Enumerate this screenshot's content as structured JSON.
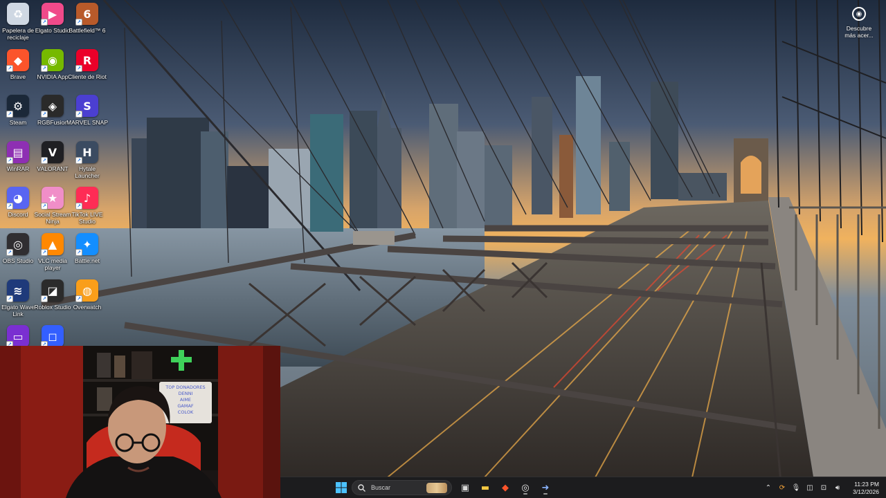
{
  "desktop": {
    "icons": [
      {
        "label": "Papelera de reciclaje",
        "icon": "recycle-bin-icon",
        "color": "#cfd8e3"
      },
      {
        "label": "Elgato Studio",
        "icon": "elgato-studio-icon",
        "color": "#f04a8a"
      },
      {
        "label": "Battlefield™ 6",
        "icon": "battlefield-icon",
        "color": "#b85a2a"
      },
      {
        "label": "Brave",
        "icon": "brave-icon",
        "color": "#fb542b"
      },
      {
        "label": "NVIDIA App",
        "icon": "nvidia-icon",
        "color": "#76b900"
      },
      {
        "label": "Cliente de Riot",
        "icon": "riot-client-icon",
        "color": "#eb0029"
      },
      {
        "label": "Steam",
        "icon": "steam-icon",
        "color": "#1b2838"
      },
      {
        "label": "RGBFusion",
        "icon": "rgbfusion-icon",
        "color": "#2a2a2a"
      },
      {
        "label": "MARVEL SNAP",
        "icon": "marvel-snap-icon",
        "color": "#4b3fd1"
      },
      {
        "label": "WinRAR",
        "icon": "winrar-icon",
        "color": "#8e2fb3"
      },
      {
        "label": "VALORANT",
        "icon": "valorant-icon",
        "color": "#1f1f23"
      },
      {
        "label": "Hytale Launcher",
        "icon": "hytale-icon",
        "color": "#3b4b61"
      },
      {
        "label": "Discord",
        "icon": "discord-icon",
        "color": "#5865f2"
      },
      {
        "label": "Social Stream Ninja",
        "icon": "social-stream-ninja-icon",
        "color": "#f08ec8"
      },
      {
        "label": "TikTok LIVE Studio",
        "icon": "tiktok-live-icon",
        "color": "#fe2c55"
      },
      {
        "label": "OBS Studio",
        "icon": "obs-icon",
        "color": "#302e31"
      },
      {
        "label": "VLC media player",
        "icon": "vlc-icon",
        "color": "#ff8800"
      },
      {
        "label": "Battle.net",
        "icon": "battlenet-icon",
        "color": "#148eff"
      },
      {
        "label": "Elgato Wave Link",
        "icon": "wave-link-icon",
        "color": "#1f3a7a"
      },
      {
        "label": "Roblox Studio",
        "icon": "roblox-studio-icon",
        "color": "#2b2b2b"
      },
      {
        "label": "Overwatch",
        "icon": "overwatch-icon",
        "color": "#f99e1a"
      },
      {
        "label": "",
        "icon": "cast-app-icon",
        "color": "#7a2fd1"
      },
      {
        "label": "",
        "icon": "roblox-icon",
        "color": "#335fff"
      }
    ],
    "discover": {
      "label": "Descubre más acer...",
      "icon": "camera-spotlight-icon"
    }
  },
  "webcam": {
    "sign_lines": [
      "TOP DONADORES",
      "DENNI",
      "AIME",
      "GAMAF",
      "COLOK"
    ]
  },
  "taskbar": {
    "search_placeholder": "Buscar",
    "apps": [
      {
        "icon": "task-view-icon",
        "running": false
      },
      {
        "icon": "file-explorer-icon",
        "running": false
      },
      {
        "icon": "brave-taskbar-icon",
        "running": false
      },
      {
        "icon": "chrome-taskbar-icon",
        "running": true
      },
      {
        "icon": "media-app-icon",
        "running": true
      }
    ],
    "clock": {
      "time": "11:23 PM",
      "date": "3/12/2026"
    }
  }
}
